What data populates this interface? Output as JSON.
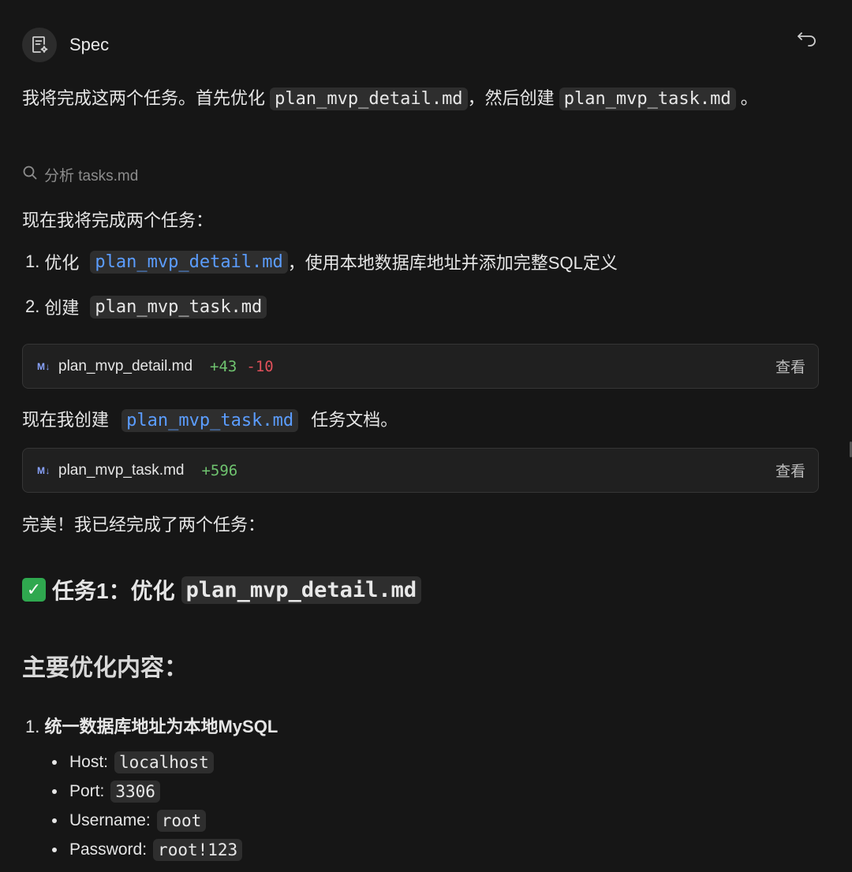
{
  "header": {
    "title": "Spec",
    "avatar_icon": "spec-doc-icon",
    "undo_icon": "undo-icon"
  },
  "intro": {
    "prefix": "我将完成这两个任务。首先优化",
    "file1": "plan_mvp_detail.md",
    "middle": "，然后创建",
    "file2": "plan_mvp_task.md",
    "suffix": "。"
  },
  "search": {
    "icon": "search-icon",
    "text": "分析 tasks.md"
  },
  "tasks_intro": "现在我将完成两个任务：",
  "task_list": [
    {
      "num": "1.",
      "prefix": "优化",
      "code": "plan_mvp_detail.md",
      "suffix": "，使用本地数据库地址并添加完整SQL定义"
    },
    {
      "num": "2.",
      "prefix": "创建",
      "code": "plan_mvp_task.md"
    }
  ],
  "cards": [
    {
      "badge": "M↓",
      "file": "plan_mvp_detail.md",
      "added": "+43",
      "removed": "-10",
      "action": "查看"
    },
    {
      "badge": "M↓",
      "file": "plan_mvp_task.md",
      "added": "+596",
      "action": "查看"
    }
  ],
  "create_line": {
    "prefix": "现在我创建",
    "code": "plan_mvp_task.md",
    "suffix": "任务文档。"
  },
  "done_line": "完美！我已经完成了两个任务：",
  "task1_heading": {
    "icon": "check-icon",
    "prefix": "任务1：优化",
    "code": "plan_mvp_detail.md"
  },
  "subheading": "主要优化内容：",
  "opt_list": {
    "num": "1.",
    "title": "统一数据库地址为本地MySQL"
  },
  "db_items": [
    {
      "label": "Host:",
      "value": "localhost"
    },
    {
      "label": "Port:",
      "value": "3306"
    },
    {
      "label": "Username:",
      "value": "root"
    },
    {
      "label": "Password:",
      "value": "root!123"
    }
  ]
}
